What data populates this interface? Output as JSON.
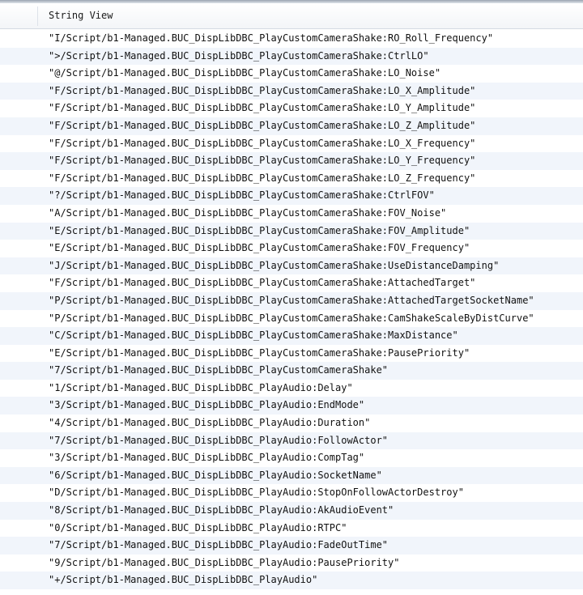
{
  "header": {
    "column_title": "String View"
  },
  "rows": [
    "\"I/Script/b1-Managed.BUC_DispLibDBC_PlayCustomCameraShake:RO_Roll_Frequency\"",
    "\">/Script/b1-Managed.BUC_DispLibDBC_PlayCustomCameraShake:CtrlLO\"",
    "\"@/Script/b1-Managed.BUC_DispLibDBC_PlayCustomCameraShake:LO_Noise\"",
    "\"F/Script/b1-Managed.BUC_DispLibDBC_PlayCustomCameraShake:LO_X_Amplitude\"",
    "\"F/Script/b1-Managed.BUC_DispLibDBC_PlayCustomCameraShake:LO_Y_Amplitude\"",
    "\"F/Script/b1-Managed.BUC_DispLibDBC_PlayCustomCameraShake:LO_Z_Amplitude\"",
    "\"F/Script/b1-Managed.BUC_DispLibDBC_PlayCustomCameraShake:LO_X_Frequency\"",
    "\"F/Script/b1-Managed.BUC_DispLibDBC_PlayCustomCameraShake:LO_Y_Frequency\"",
    "\"F/Script/b1-Managed.BUC_DispLibDBC_PlayCustomCameraShake:LO_Z_Frequency\"",
    "\"?/Script/b1-Managed.BUC_DispLibDBC_PlayCustomCameraShake:CtrlFOV\"",
    "\"A/Script/b1-Managed.BUC_DispLibDBC_PlayCustomCameraShake:FOV_Noise\"",
    "\"E/Script/b1-Managed.BUC_DispLibDBC_PlayCustomCameraShake:FOV_Amplitude\"",
    "\"E/Script/b1-Managed.BUC_DispLibDBC_PlayCustomCameraShake:FOV_Frequency\"",
    "\"J/Script/b1-Managed.BUC_DispLibDBC_PlayCustomCameraShake:UseDistanceDamping\"",
    "\"F/Script/b1-Managed.BUC_DispLibDBC_PlayCustomCameraShake:AttachedTarget\"",
    "\"P/Script/b1-Managed.BUC_DispLibDBC_PlayCustomCameraShake:AttachedTargetSocketName\"",
    "\"P/Script/b1-Managed.BUC_DispLibDBC_PlayCustomCameraShake:CamShakeScaleByDistCurve\"",
    "\"C/Script/b1-Managed.BUC_DispLibDBC_PlayCustomCameraShake:MaxDistance\"",
    "\"E/Script/b1-Managed.BUC_DispLibDBC_PlayCustomCameraShake:PausePriority\"",
    "\"7/Script/b1-Managed.BUC_DispLibDBC_PlayCustomCameraShake\"",
    "\"1/Script/b1-Managed.BUC_DispLibDBC_PlayAudio:Delay\"",
    "\"3/Script/b1-Managed.BUC_DispLibDBC_PlayAudio:EndMode\"",
    "\"4/Script/b1-Managed.BUC_DispLibDBC_PlayAudio:Duration\"",
    "\"7/Script/b1-Managed.BUC_DispLibDBC_PlayAudio:FollowActor\"",
    "\"3/Script/b1-Managed.BUC_DispLibDBC_PlayAudio:CompTag\"",
    "\"6/Script/b1-Managed.BUC_DispLibDBC_PlayAudio:SocketName\"",
    "\"D/Script/b1-Managed.BUC_DispLibDBC_PlayAudio:StopOnFollowActorDestroy\"",
    "\"8/Script/b1-Managed.BUC_DispLibDBC_PlayAudio:AkAudioEvent\"",
    "\"0/Script/b1-Managed.BUC_DispLibDBC_PlayAudio:RTPC\"",
    "\"7/Script/b1-Managed.BUC_DispLibDBC_PlayAudio:FadeOutTime\"",
    "\"9/Script/b1-Managed.BUC_DispLibDBC_PlayAudio:PausePriority\"",
    "\"+/Script/b1-Managed.BUC_DispLibDBC_PlayAudio\""
  ]
}
